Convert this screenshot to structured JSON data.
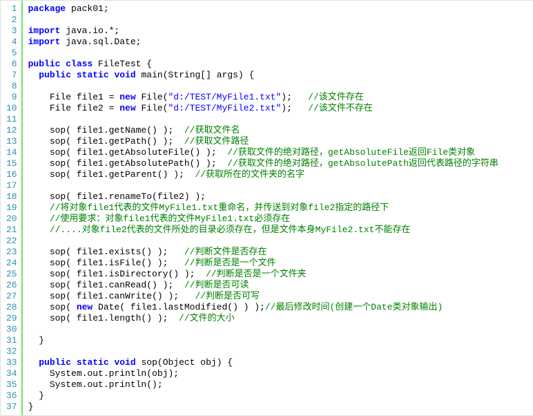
{
  "lines": [
    {
      "n": 1,
      "parts": [
        {
          "cls": "kw",
          "t": "package"
        },
        {
          "t": " pack01;"
        }
      ]
    },
    {
      "n": 2,
      "parts": []
    },
    {
      "n": 3,
      "parts": [
        {
          "cls": "kw",
          "t": "import"
        },
        {
          "t": " java.io.*;"
        }
      ]
    },
    {
      "n": 4,
      "parts": [
        {
          "cls": "kw",
          "t": "import"
        },
        {
          "t": " java.sql.Date;"
        }
      ]
    },
    {
      "n": 5,
      "parts": []
    },
    {
      "n": 6,
      "parts": [
        {
          "cls": "kw",
          "t": "public"
        },
        {
          "t": " "
        },
        {
          "cls": "kw",
          "t": "class"
        },
        {
          "t": " FileTest {"
        }
      ]
    },
    {
      "n": 7,
      "parts": [
        {
          "t": "  "
        },
        {
          "cls": "kw",
          "t": "public"
        },
        {
          "t": " "
        },
        {
          "cls": "kw",
          "t": "static"
        },
        {
          "t": " "
        },
        {
          "cls": "kw",
          "t": "void"
        },
        {
          "t": " main(String[] args) {"
        }
      ]
    },
    {
      "n": 8,
      "parts": []
    },
    {
      "n": 9,
      "parts": [
        {
          "t": "    File file1 = "
        },
        {
          "cls": "kw",
          "t": "new"
        },
        {
          "t": " File("
        },
        {
          "cls": "str",
          "t": "\"d:/TEST/MyFile1.txt\""
        },
        {
          "t": ");   "
        },
        {
          "cls": "cmt",
          "t": "//该文件存在"
        }
      ]
    },
    {
      "n": 10,
      "parts": [
        {
          "t": "    File file2 = "
        },
        {
          "cls": "kw",
          "t": "new"
        },
        {
          "t": " File("
        },
        {
          "cls": "str",
          "t": "\"d:/TEST/MyFile2.txt\""
        },
        {
          "t": ");   "
        },
        {
          "cls": "cmt",
          "t": "//该文件不存在"
        }
      ]
    },
    {
      "n": 11,
      "parts": []
    },
    {
      "n": 12,
      "parts": [
        {
          "t": "    sop( file1.getName() );  "
        },
        {
          "cls": "cmt",
          "t": "//获取文件名"
        }
      ]
    },
    {
      "n": 13,
      "parts": [
        {
          "t": "    sop( file1.getPath() );  "
        },
        {
          "cls": "cmt",
          "t": "//获取文件路径"
        }
      ]
    },
    {
      "n": 14,
      "parts": [
        {
          "t": "    sop( file1.getAbsoluteFile() );  "
        },
        {
          "cls": "cmt",
          "t": "//获取文件的绝对路径，getAbsoluteFile返回File类对象"
        }
      ]
    },
    {
      "n": 15,
      "parts": [
        {
          "t": "    sop( file1.getAbsolutePath() );  "
        },
        {
          "cls": "cmt",
          "t": "//获取文件的绝对路径，getAbsolutePath返回代表路径的字符串"
        }
      ]
    },
    {
      "n": 16,
      "parts": [
        {
          "t": "    sop( file1.getParent() );  "
        },
        {
          "cls": "cmt",
          "t": "//获取所在的文件夹的名字"
        }
      ]
    },
    {
      "n": 17,
      "parts": []
    },
    {
      "n": 18,
      "parts": [
        {
          "t": "    sop( file1.renameTo(file2) );"
        }
      ]
    },
    {
      "n": 19,
      "parts": [
        {
          "t": "    "
        },
        {
          "cls": "cmt",
          "t": "//将对象file1代表的文件MyFile1.txt重命名，并传送到对象file2指定的路径下"
        }
      ]
    },
    {
      "n": 20,
      "parts": [
        {
          "t": "    "
        },
        {
          "cls": "cmt",
          "t": "//使用要求：对象file1代表的文件MyFile1.txt必须存在"
        }
      ]
    },
    {
      "n": 21,
      "parts": [
        {
          "t": "    "
        },
        {
          "cls": "cmt",
          "t": "//....对象file2代表的文件所处的目录必须存在，但是文件本身MyFile2.txt不能存在"
        }
      ]
    },
    {
      "n": 22,
      "parts": []
    },
    {
      "n": 23,
      "parts": [
        {
          "t": "    sop( file1.exists() );   "
        },
        {
          "cls": "cmt",
          "t": "//判断文件是否存在"
        }
      ]
    },
    {
      "n": 24,
      "parts": [
        {
          "t": "    sop( file1.isFile() );   "
        },
        {
          "cls": "cmt",
          "t": "//判断是否是一个文件"
        }
      ]
    },
    {
      "n": 25,
      "parts": [
        {
          "t": "    sop( file1.isDirectory() );  "
        },
        {
          "cls": "cmt",
          "t": "//判断是否是一个文件夹"
        }
      ]
    },
    {
      "n": 26,
      "parts": [
        {
          "t": "    sop( file1.canRead() );  "
        },
        {
          "cls": "cmt",
          "t": "//判断是否可读"
        }
      ]
    },
    {
      "n": 27,
      "parts": [
        {
          "t": "    sop( file1.canWrite() );   "
        },
        {
          "cls": "cmt",
          "t": "//判断是否可写"
        }
      ]
    },
    {
      "n": 28,
      "parts": [
        {
          "t": "    sop( "
        },
        {
          "cls": "kw",
          "t": "new"
        },
        {
          "t": " Date( file1.lastModified() ) );"
        },
        {
          "cls": "cmt",
          "t": "//最后修改时间(创建一个Date类对象输出)"
        }
      ]
    },
    {
      "n": 29,
      "parts": [
        {
          "t": "    sop( file1.length() );  "
        },
        {
          "cls": "cmt",
          "t": "//文件的大小"
        }
      ]
    },
    {
      "n": 30,
      "parts": []
    },
    {
      "n": 31,
      "parts": [
        {
          "t": "  }"
        }
      ]
    },
    {
      "n": 32,
      "parts": []
    },
    {
      "n": 33,
      "parts": [
        {
          "t": "  "
        },
        {
          "cls": "kw",
          "t": "public"
        },
        {
          "t": " "
        },
        {
          "cls": "kw",
          "t": "static"
        },
        {
          "t": " "
        },
        {
          "cls": "kw",
          "t": "void"
        },
        {
          "t": " sop(Object obj) {"
        }
      ]
    },
    {
      "n": 34,
      "parts": [
        {
          "t": "    System.out.println(obj);"
        }
      ]
    },
    {
      "n": 35,
      "parts": [
        {
          "t": "    System.out.println();"
        }
      ]
    },
    {
      "n": 36,
      "parts": [
        {
          "t": "  }"
        }
      ]
    },
    {
      "n": 37,
      "parts": [
        {
          "t": "}"
        }
      ]
    }
  ]
}
